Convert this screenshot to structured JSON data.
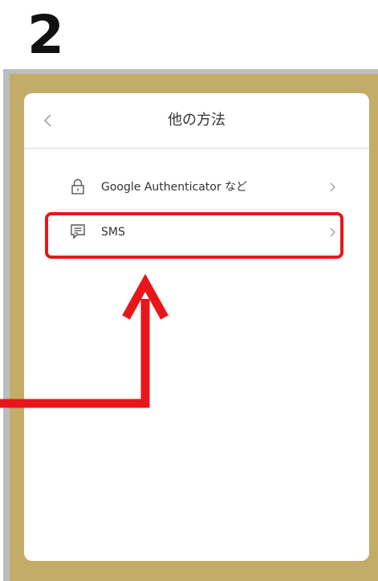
{
  "step": {
    "number": "2"
  },
  "header": {
    "back_icon": "chevron-left-icon",
    "title": "他の方法"
  },
  "methods": [
    {
      "icon": "lock-icon",
      "label": "Google Authenticator など",
      "chevron": "chevron-right-icon"
    },
    {
      "icon": "message-icon",
      "label": "SMS",
      "chevron": "chevron-right-icon"
    }
  ],
  "annotation": {
    "highlight_color": "#e8161b",
    "target": "SMS"
  },
  "colors": {
    "frame_gold": "#c3ab68",
    "accent_red": "#e8161b"
  }
}
